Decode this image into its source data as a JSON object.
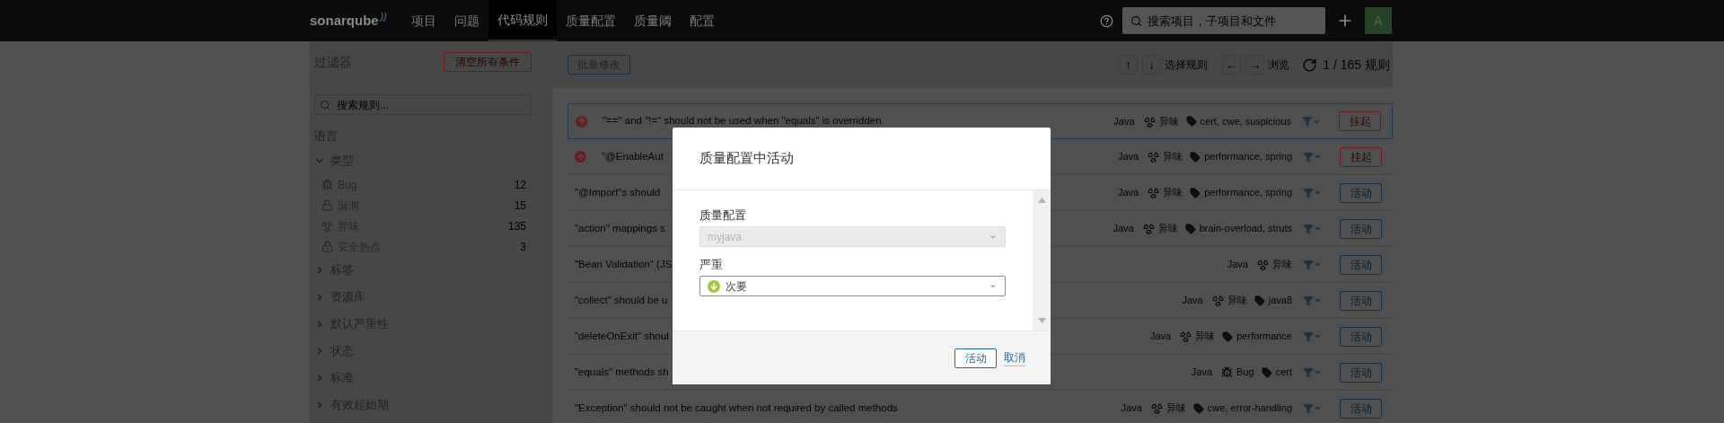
{
  "top_nav": {
    "logo": "sonarqube",
    "items": [
      {
        "label": "项目",
        "selected": false
      },
      {
        "label": "问题",
        "selected": false
      },
      {
        "label": "代码规则",
        "selected": true
      },
      {
        "label": "质量配置",
        "selected": false
      },
      {
        "label": "质量阈",
        "selected": false
      },
      {
        "label": "配置",
        "selected": false
      }
    ],
    "search": {
      "placeholder": "搜索项目，子项目和文件"
    },
    "avatar": "A"
  },
  "sidebar": {
    "title": "过滤器",
    "clear_button": "清空所有条件",
    "search": {
      "placeholder": "搜索规则..."
    },
    "facets": [
      {
        "label": "语言",
        "kind": "static"
      },
      {
        "label": "类型",
        "kind": "toggle",
        "expanded": true,
        "items": [
          {
            "label": "Bug",
            "count": "12",
            "kind": "bug"
          },
          {
            "label": "漏洞",
            "count": "15",
            "kind": "vulnerability"
          },
          {
            "label": "异味",
            "count": "135",
            "kind": "code_smell"
          },
          {
            "label": "安全热点",
            "count": "3",
            "kind": "hotspot"
          }
        ]
      },
      {
        "label": "标签",
        "kind": "toggle",
        "expanded": false
      },
      {
        "label": "资源库",
        "kind": "toggle",
        "expanded": false
      },
      {
        "label": "默认严重性",
        "kind": "toggle",
        "expanded": false
      },
      {
        "label": "状态",
        "kind": "toggle",
        "expanded": false
      },
      {
        "label": "标准",
        "kind": "toggle",
        "expanded": false
      },
      {
        "label": "有效起始期",
        "kind": "toggle",
        "expanded": false
      }
    ]
  },
  "toolbar": {
    "bulk_button": "批量修改",
    "up": "↑",
    "down": "↓",
    "select_label": "选择规则",
    "prev": "←",
    "next": "→",
    "browse_label": "浏览",
    "count": "1 / 165 规则"
  },
  "rules": [
    {
      "kind": "activated",
      "title": "\"==\" and \"!=\" should not be used when \"equals\" is overridden",
      "language": "Java",
      "type": {
        "kind": "code_smell",
        "label": "异味"
      },
      "tags": "cert, cwe, suspicious",
      "action": {
        "kind": "deactivate",
        "label": "挂起"
      },
      "selected": true
    },
    {
      "kind": "activated",
      "title": "\"@EnableAut",
      "language": "Java",
      "type": {
        "kind": "code_smell",
        "label": "异味"
      },
      "tags": "performance, spring",
      "action": {
        "kind": "deactivate",
        "label": "挂起"
      },
      "selected": false
    },
    {
      "title": "\"@Import\"s should",
      "language": "Java",
      "type": {
        "kind": "code_smell",
        "label": "异味"
      },
      "tags": "performance, spring",
      "action": {
        "kind": "activate",
        "label": "活动"
      },
      "selected": false
    },
    {
      "title": "\"action\" mappings s",
      "language": "Java",
      "type": {
        "kind": "code_smell",
        "label": "异味"
      },
      "tags": "brain-overload, struts",
      "action": {
        "kind": "activate",
        "label": "活动"
      },
      "selected": false
    },
    {
      "title": "\"Bean Validation\" (JS",
      "language": "Java",
      "type": {
        "kind": "code_smell",
        "label": "异味"
      },
      "action": {
        "kind": "activate",
        "label": "活动"
      },
      "selected": false
    },
    {
      "title": "\"collect\" should be u",
      "language": "Java",
      "type": {
        "kind": "code_smell",
        "label": "异味"
      },
      "tags": "java8",
      "action": {
        "kind": "activate",
        "label": "活动"
      },
      "selected": false
    },
    {
      "title": "\"deleteOnExit\" shoul",
      "language": "Java",
      "type": {
        "kind": "code_smell",
        "label": "异味"
      },
      "tags": "performance",
      "action": {
        "kind": "activate",
        "label": "活动"
      },
      "selected": false
    },
    {
      "title": "\"equals\" methods sh",
      "language": "Java",
      "type": {
        "kind": "bug",
        "label": "Bug"
      },
      "tags": "cert",
      "action": {
        "kind": "activate",
        "label": "活动"
      },
      "selected": false
    },
    {
      "title": "\"Exception\" should not be caught when not required by called methods",
      "language": "Java",
      "type": {
        "kind": "code_smell",
        "label": "异味"
      },
      "tags": "cwe, error-handling",
      "action": {
        "kind": "activate",
        "label": "活动"
      },
      "selected": false
    }
  ],
  "modal": {
    "title": "质量配置中活动",
    "fields": [
      {
        "label": "质量配置",
        "value": "myjava",
        "disabled": true
      },
      {
        "kind": "severity",
        "label": "严重",
        "value": "次要",
        "disabled": false
      }
    ],
    "buttons": [
      {
        "kind": "primary",
        "label": "活动"
      },
      {
        "kind": "link",
        "label": "取消"
      }
    ]
  }
}
